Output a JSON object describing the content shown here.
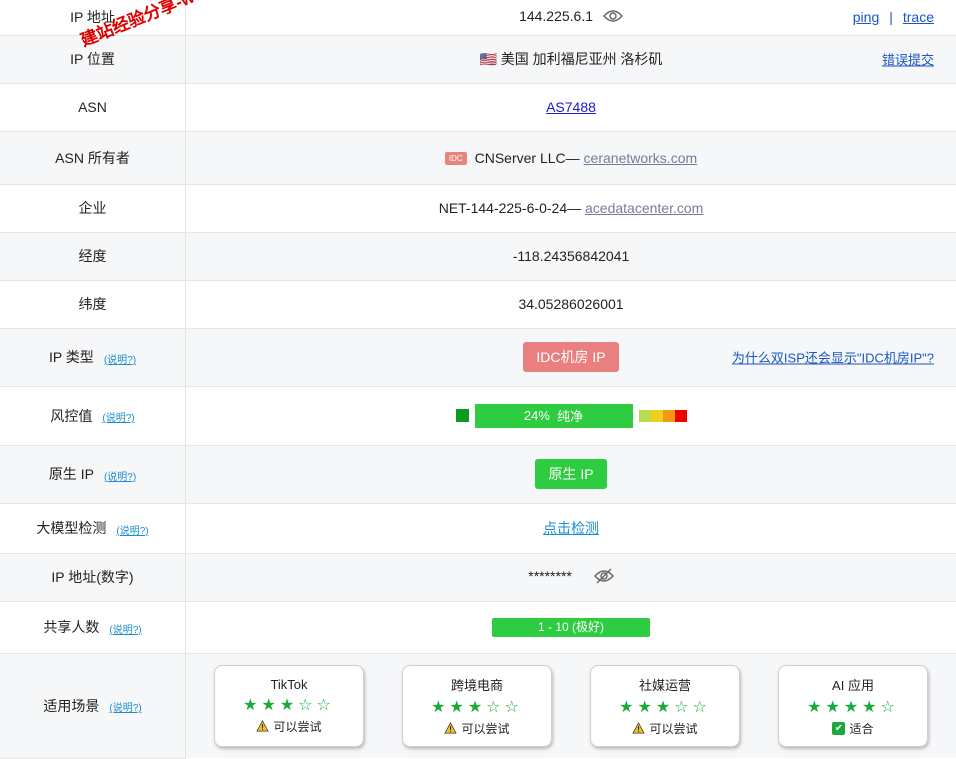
{
  "watermark": "建站经验分享-www.w",
  "rows": {
    "ip": {
      "label": "IP 地址",
      "value": "144.225.6.1",
      "ping": "ping",
      "sep": "|",
      "trace": "trace"
    },
    "location": {
      "label": "IP 位置",
      "flag": "🇺🇸",
      "value": "美国 加利福尼亚州 洛杉矶",
      "action": "错误提交"
    },
    "asn": {
      "label": "ASN",
      "value": "AS7488"
    },
    "asn_owner": {
      "label": "ASN 所有者",
      "tag": "IDC",
      "name": "CNServer LLC—",
      "domain": "ceranetworks.com"
    },
    "company": {
      "label": "企业",
      "name": "NET-144-225-6-0-24—",
      "domain": "acedatacenter.com"
    },
    "longitude": {
      "label": "经度",
      "value": "-118.24356842041"
    },
    "latitude": {
      "label": "纬度",
      "value": "34.05286026001"
    },
    "ip_type": {
      "label": "IP 类型",
      "help": "(说明?)",
      "badge": "IDC机房 IP",
      "note": "为什么双ISP还会显示\"IDC机房IP\"?"
    },
    "risk": {
      "label": "风控值",
      "help": "(说明?)",
      "percent": "24%",
      "verdict": "纯净",
      "level": 0.24
    },
    "native": {
      "label": "原生 IP",
      "help": "(说明?)",
      "badge": "原生 IP"
    },
    "llm": {
      "label": "大模型检测",
      "help": "(说明?)",
      "link": "点击检测"
    },
    "ip_number": {
      "label": "IP 地址(数字)",
      "masked": "********"
    },
    "sharing": {
      "label": "共享人数",
      "help": "(说明?)",
      "value": "1 - 10 (极好)"
    },
    "scenes": {
      "label": "适用场景",
      "help": "(说明?)",
      "cards": [
        {
          "name": "TikTok",
          "rating": 3,
          "status": "可以尝试",
          "status_icon": "warning-icon"
        },
        {
          "name": "跨境电商",
          "rating": 3,
          "status": "可以尝试",
          "status_icon": "warning-icon"
        },
        {
          "name": "社媒运营",
          "rating": 3,
          "status": "可以尝试",
          "status_icon": "warning-icon"
        },
        {
          "name": "AI 应用",
          "rating": 4,
          "status": "适合",
          "status_icon": "check-icon"
        }
      ]
    }
  },
  "colors": {
    "green": "#2ecc40",
    "red_badge": "#ea7f7f",
    "link": "#1a56c4",
    "risk_scale": [
      "#b6e04a",
      "#f0d020",
      "#f49a10",
      "#f00000"
    ]
  }
}
